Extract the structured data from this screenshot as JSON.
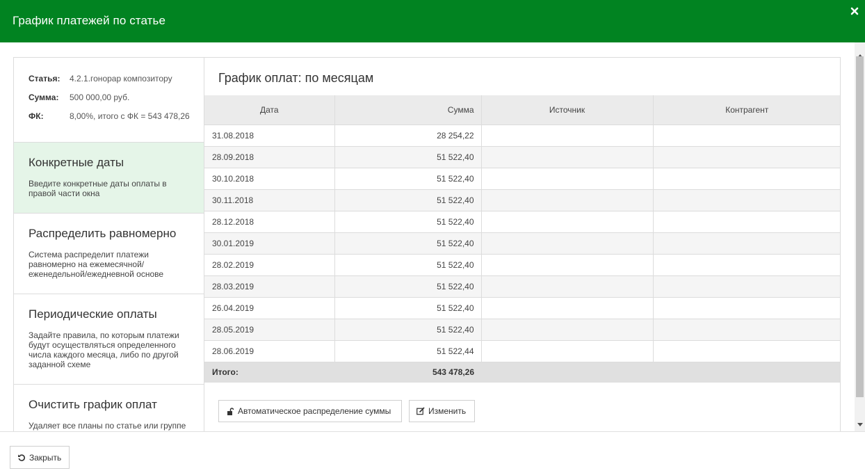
{
  "header": {
    "title": "График платежей по статье",
    "close_icon": "close-icon"
  },
  "info": {
    "article_label": "Статья:",
    "article_value": "4.2.1.гонорар композитору",
    "sum_label": "Сумма:",
    "sum_value": "500 000,00 руб.",
    "fk_label": "ФК:",
    "fk_value": "8,00%, итого с ФК = 543 478,26"
  },
  "options": [
    {
      "title": "Конкретные даты",
      "desc": "Введите конкретные даты оплаты в правой части окна"
    },
    {
      "title": "Распределить равномерно",
      "desc": "Система распределит платежи равномерно на ежемесячной/ еженедельной/ежедневной основе"
    },
    {
      "title": "Периодические оплаты",
      "desc": "Задайте правила, по которым платежи будут осуществляться определенного числа каждого месяца, либо по другой заданной схеме"
    },
    {
      "title": "Очистить график оплат",
      "desc": "Удаляет все планы по статье или группе"
    }
  ],
  "schedule": {
    "title": "График оплат: по месяцам",
    "columns": [
      "Дата",
      "Сумма",
      "Источник",
      "Контрагент"
    ],
    "rows": [
      {
        "date": "31.08.2018",
        "sum": "28 254,22",
        "source": "",
        "counterparty": ""
      },
      {
        "date": "28.09.2018",
        "sum": "51 522,40",
        "source": "",
        "counterparty": ""
      },
      {
        "date": "30.10.2018",
        "sum": "51 522,40",
        "source": "",
        "counterparty": ""
      },
      {
        "date": "30.11.2018",
        "sum": "51 522,40",
        "source": "",
        "counterparty": ""
      },
      {
        "date": "28.12.2018",
        "sum": "51 522,40",
        "source": "",
        "counterparty": ""
      },
      {
        "date": "30.01.2019",
        "sum": "51 522,40",
        "source": "",
        "counterparty": ""
      },
      {
        "date": "28.02.2019",
        "sum": "51 522,40",
        "source": "",
        "counterparty": ""
      },
      {
        "date": "28.03.2019",
        "sum": "51 522,40",
        "source": "",
        "counterparty": ""
      },
      {
        "date": "26.04.2019",
        "sum": "51 522,40",
        "source": "",
        "counterparty": ""
      },
      {
        "date": "28.05.2019",
        "sum": "51 522,40",
        "source": "",
        "counterparty": ""
      },
      {
        "date": "28.06.2019",
        "sum": "51 522,44",
        "source": "",
        "counterparty": ""
      }
    ],
    "total_label": "Итого:",
    "total_value": "543 478,26"
  },
  "buttons": {
    "auto_label": "Автоматическое распределение суммы",
    "edit_label": "Изменить",
    "close_label": "Закрыть"
  },
  "colors": {
    "header_bg": "#018321",
    "active_option_bg": "#e5f5e8"
  }
}
